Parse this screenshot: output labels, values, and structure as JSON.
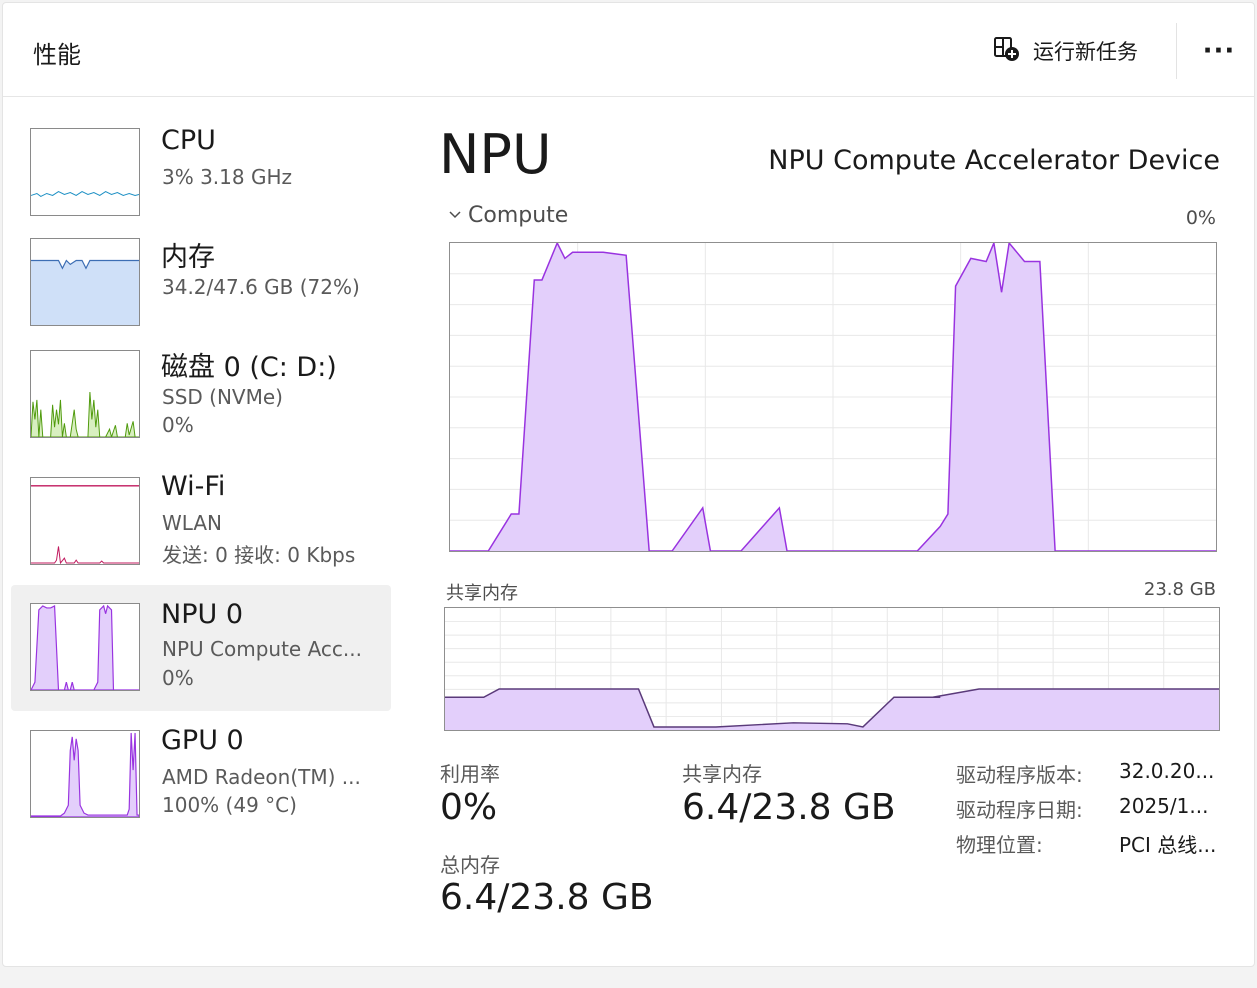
{
  "header": {
    "title": "性能",
    "run_task_label": "运行新任务",
    "more_label": "···"
  },
  "sidebar": {
    "items": [
      {
        "title": "CPU",
        "sub1": "3%  3.18 GHz",
        "sub2": ""
      },
      {
        "title": "内存",
        "sub1": "34.2/47.6 GB (72%)",
        "sub2": ""
      },
      {
        "title": "磁盘 0 (C: D:)",
        "sub1": "SSD (NVMe)",
        "sub2": "0%"
      },
      {
        "title": "Wi-Fi",
        "sub1": "WLAN",
        "sub2": "发送: 0 接收: 0 Kbps"
      },
      {
        "title": "NPU 0",
        "sub1": "NPU Compute Acc...",
        "sub2": "0%"
      },
      {
        "title": "GPU 0",
        "sub1": "AMD Radeon(TM) ...",
        "sub2": "100%  (49 °C)"
      }
    ]
  },
  "main": {
    "title": "NPU",
    "device_name": "NPU Compute Accelerator Device",
    "compute_label": "Compute",
    "compute_pct": "0%",
    "shared_label": "共享内存",
    "shared_max": "23.8 GB",
    "stats": {
      "utilization_label": "利用率",
      "utilization_value": "0%",
      "shared_mem_label": "共享内存",
      "shared_mem_value": "6.4/23.8 GB",
      "total_mem_label": "总内存",
      "total_mem_value": "6.4/23.8 GB"
    },
    "details": [
      {
        "label": "驱动程序版本:",
        "value": "32.0.20..."
      },
      {
        "label": "驱动程序日期:",
        "value": "2025/1..."
      },
      {
        "label": "物理位置:",
        "value": "PCI 总线..."
      }
    ]
  },
  "colors": {
    "npu_line": "#9933e0",
    "npu_fill": "#e3cffb",
    "cpu_line": "#1b8fc4",
    "mem_line": "#3d6eb4",
    "mem_fill": "#cfe0f8",
    "disk_line": "#4f9a0c",
    "disk_fill": "#d8efc0",
    "wifi_line": "#c0185d",
    "grid": "#e8e8e8"
  },
  "chart_data": [
    {
      "name": "compute",
      "type": "area",
      "ylim": [
        0,
        100
      ],
      "x": [
        0,
        5,
        8,
        9,
        11,
        12,
        14,
        15,
        16,
        20,
        23,
        26,
        28,
        29,
        33,
        34,
        37,
        38,
        43,
        44,
        45,
        53,
        61,
        64,
        65,
        66,
        68,
        70,
        71,
        72,
        73,
        75,
        77,
        79,
        80,
        82,
        83,
        100
      ],
      "y": [
        0,
        0,
        12,
        12,
        88,
        88,
        100,
        95,
        97,
        97,
        96,
        0,
        0,
        0,
        14,
        0,
        0,
        0,
        14,
        0,
        0,
        0,
        0,
        8,
        12,
        86,
        95,
        94,
        100,
        84,
        100,
        94,
        94,
        0,
        0,
        0,
        0,
        0
      ]
    },
    {
      "name": "shared_memory",
      "type": "area",
      "ylim": [
        0,
        23.8
      ],
      "x": [
        0,
        5,
        7,
        10,
        20,
        25,
        27,
        35,
        45,
        52,
        54,
        58,
        61,
        64,
        63,
        69,
        75,
        80,
        100
      ],
      "y": [
        6.4,
        6.4,
        8.0,
        8.0,
        8.0,
        8.0,
        0.6,
        0.6,
        1.4,
        1.2,
        0.6,
        6.4,
        6.4,
        6.4,
        6.4,
        8.0,
        8.0,
        8.0,
        8.0
      ]
    }
  ]
}
